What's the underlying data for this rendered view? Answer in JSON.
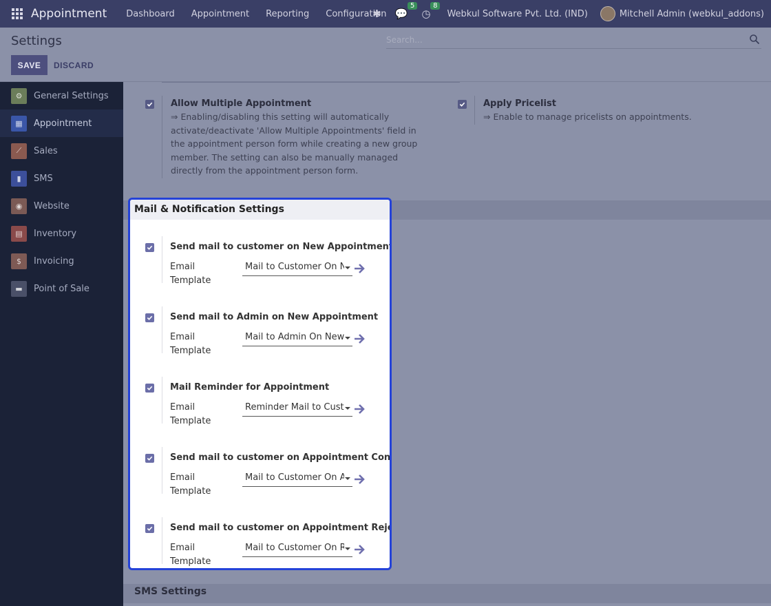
{
  "navbar": {
    "app_name": "Appointment",
    "menu": [
      "Dashboard",
      "Appointment",
      "Reporting",
      "Configuration"
    ],
    "messages_count": "5",
    "activities_count": "8",
    "company": "Webkul Software Pvt. Ltd. (IND)",
    "user": "Mitchell Admin (webkul_addons)"
  },
  "control": {
    "title": "Settings",
    "search_placeholder": "Search...",
    "save_label": "SAVE",
    "discard_label": "DISCARD"
  },
  "sidebar": {
    "items": [
      {
        "label": "General Settings",
        "icon": "gear-icon",
        "color": "#6b7d5a"
      },
      {
        "label": "Appointment",
        "icon": "calendar-grid-icon",
        "color": "#3a56a8"
      },
      {
        "label": "Sales",
        "icon": "chart-icon",
        "color": "#8a5a50"
      },
      {
        "label": "SMS",
        "icon": "phone-icon",
        "color": "#3c4f9a"
      },
      {
        "label": "Website",
        "icon": "globe-icon",
        "color": "#7b5a55"
      },
      {
        "label": "Inventory",
        "icon": "box-icon",
        "color": "#8a4a4a"
      },
      {
        "label": "Invoicing",
        "icon": "invoice-icon",
        "color": "#7e5a55"
      },
      {
        "label": "Point of Sale",
        "icon": "store-icon",
        "color": "#4a5068"
      }
    ]
  },
  "settings": {
    "multi_title": "Allow Multiple Appointment",
    "multi_desc": "⇒ Enabling/disabling this setting will automatically activate/deactivate 'Allow Multiple Appointments' field in the appointment person form while creating a new group member. The setting can also be manually managed directly from the appointment person form.",
    "pricelist_title": "Apply Pricelist",
    "pricelist_desc": "⇒ Enable to manage pricelists on appointments."
  },
  "mail_section": {
    "title": "Mail & Notification Settings",
    "template_label": "Email Template",
    "items": [
      {
        "title": "Send mail to customer on New Appointment",
        "template": "Mail to Customer On New Appointment"
      },
      {
        "title": "Send mail to Admin on New Appointment",
        "template": "Mail to Admin On New Appointment"
      },
      {
        "title": "Mail Reminder for Appointment",
        "template": "Reminder Mail to Customer"
      },
      {
        "title": "Send mail to customer on Appointment Confirmation",
        "template": "Mail to Customer On Appointment Confirmation"
      },
      {
        "title": "Send mail to customer on Appointment Reject",
        "template": "Mail to Customer On Reject"
      }
    ]
  },
  "sms_section": {
    "title": "SMS Settings"
  }
}
